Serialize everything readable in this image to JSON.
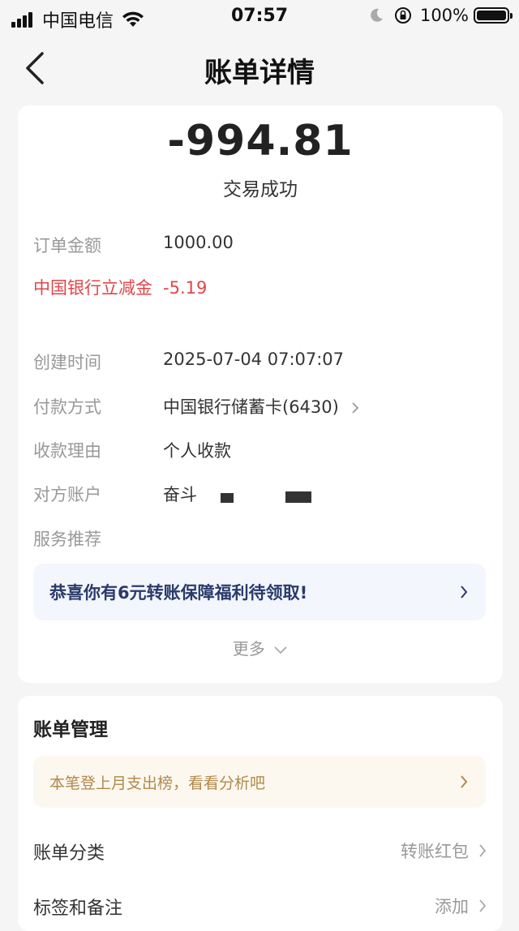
{
  "status_bar": {
    "carrier": "中国电信",
    "time": "07:57",
    "battery": "100%"
  },
  "nav": {
    "title": "账单详情"
  },
  "summary": {
    "amount": "-994.81",
    "status": "交易成功"
  },
  "details": [
    {
      "label": "订单金额",
      "value": "1000.00"
    },
    {
      "label": "中国银行立减金",
      "value": "-5.19"
    },
    {
      "label": "创建时间",
      "value": "2025-07-04 07:07:07"
    },
    {
      "label": "付款方式",
      "value": "中国银行储蓄卡(6430)"
    },
    {
      "label": "收款理由",
      "value": "个人收款"
    },
    {
      "label": "对方账户",
      "value": "奋斗"
    },
    {
      "label": "服务推荐",
      "value": ""
    }
  ],
  "promo": {
    "text": "恭喜你有6元转账保障福利待领取!"
  },
  "more": {
    "label": "更多"
  },
  "management": {
    "title": "账单管理",
    "analysis_text": "本笔登上月支出榜，看看分析吧",
    "rows": [
      {
        "label": "账单分类",
        "value": "转账红包"
      },
      {
        "label": "标签和备注",
        "value": "添加"
      }
    ]
  },
  "colors": {
    "accent_red": "#e0464a",
    "promo_text": "#2a3a6a",
    "analysis_text": "#b0894a"
  }
}
